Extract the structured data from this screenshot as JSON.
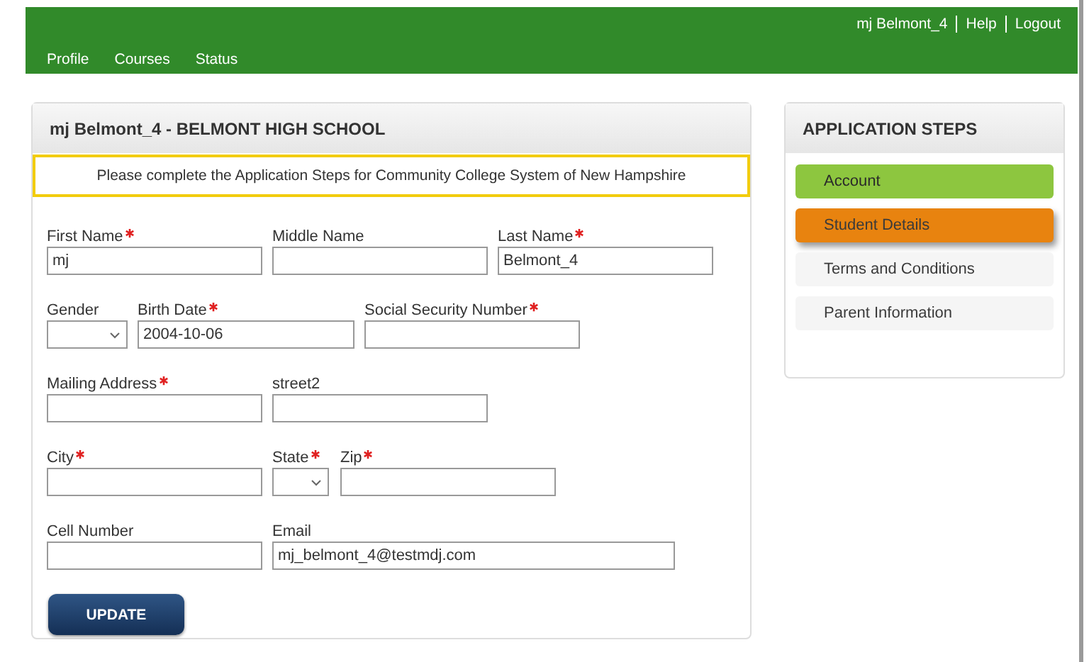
{
  "user_menu": [
    {
      "label": "mj Belmont_4"
    },
    {
      "label": "Help"
    },
    {
      "label": "Logout"
    }
  ],
  "nav": [
    {
      "label": "Profile"
    },
    {
      "label": "Courses"
    },
    {
      "label": "Status"
    }
  ],
  "form_panel": {
    "title": "mj Belmont_4 - BELMONT HIGH SCHOOL",
    "notice": "Please complete the Application Steps for Community College System of New Hampshire",
    "rows": [
      [
        {
          "label": "First Name",
          "required": true,
          "kind": "text",
          "value": "mj"
        },
        {
          "label": "Middle Name",
          "required": false,
          "kind": "text"
        },
        {
          "label": "Last Name",
          "required": true,
          "kind": "text",
          "value": "Belmont_4"
        }
      ],
      [
        {
          "label": "Gender",
          "required": false,
          "kind": "select"
        },
        {
          "label": "Birth Date",
          "required": true,
          "kind": "text",
          "value": "2004-10-06"
        },
        {
          "label": "Social Security Number",
          "required": true,
          "kind": "text"
        }
      ],
      [
        {
          "label": "Mailing Address",
          "required": true,
          "kind": "text"
        },
        {
          "label": "street2",
          "required": false,
          "kind": "text"
        }
      ],
      [
        {
          "label": "City",
          "required": true,
          "kind": "text"
        },
        {
          "label": "State",
          "required": true,
          "kind": "select"
        },
        {
          "label": "Zip",
          "required": true,
          "kind": "text"
        }
      ],
      [
        {
          "label": "Cell Number",
          "required": false,
          "kind": "text"
        },
        {
          "label": "Email",
          "required": false,
          "kind": "text",
          "value": "mj_belmont_4@testmdj.com"
        }
      ]
    ],
    "button": "UPDATE"
  },
  "steps_panel": {
    "title": "APPLICATION STEPS",
    "steps": [
      {
        "label": "Account",
        "completed": true,
        "selected": false
      },
      {
        "label": "Student Details",
        "completed": false,
        "selected": true
      },
      {
        "label": "Terms and Conditions",
        "completed": false,
        "selected": false
      },
      {
        "label": "Parent Information",
        "completed": false,
        "selected": false
      }
    ]
  }
}
